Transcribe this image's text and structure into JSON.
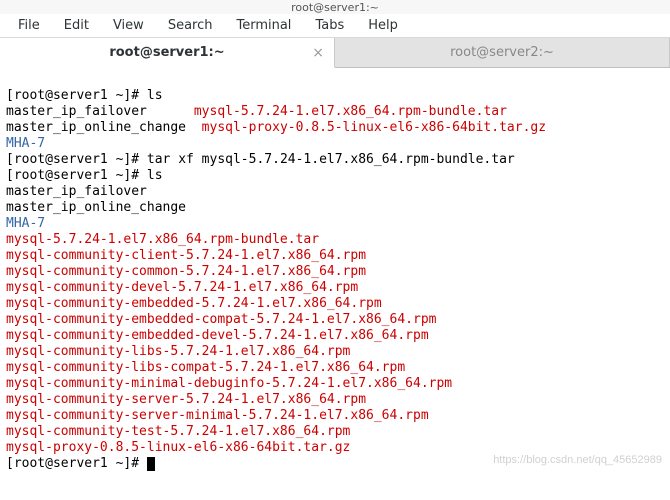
{
  "window": {
    "title": "root@server1:~"
  },
  "menu": {
    "file": "File",
    "edit": "Edit",
    "view": "View",
    "search": "Search",
    "terminal": "Terminal",
    "tabs": "Tabs",
    "help": "Help"
  },
  "tabs": [
    {
      "label": "root@server1:~",
      "active": true
    },
    {
      "label": "root@server2:~",
      "active": false
    }
  ],
  "close_glyph": "×",
  "term": {
    "prompt1": "[root@server1 ~]# ",
    "cmd_ls": "ls",
    "cmd_tar": "tar xf mysql-5.7.24-1.el7.x86_64.rpm-bundle.tar",
    "ls1_left1": "master_ip_failover",
    "ls1_pad1": "      ",
    "ls1_right1": "mysql-5.7.24-1.el7.x86_64.rpm-bundle.tar",
    "ls1_left2": "master_ip_online_change",
    "ls1_pad2": "  ",
    "ls1_right2": "mysql-proxy-0.8.5-linux-el6-x86-64bit.tar.gz",
    "mha": "MHA-7",
    "ls2_l1": "master_ip_failover",
    "ls2_l2": "master_ip_online_change",
    "rpm1": "mysql-5.7.24-1.el7.x86_64.rpm-bundle.tar",
    "rpm2": "mysql-community-client-5.7.24-1.el7.x86_64.rpm",
    "rpm3": "mysql-community-common-5.7.24-1.el7.x86_64.rpm",
    "rpm4": "mysql-community-devel-5.7.24-1.el7.x86_64.rpm",
    "rpm5": "mysql-community-embedded-5.7.24-1.el7.x86_64.rpm",
    "rpm6": "mysql-community-embedded-compat-5.7.24-1.el7.x86_64.rpm",
    "rpm7": "mysql-community-embedded-devel-5.7.24-1.el7.x86_64.rpm",
    "rpm8": "mysql-community-libs-5.7.24-1.el7.x86_64.rpm",
    "rpm9": "mysql-community-libs-compat-5.7.24-1.el7.x86_64.rpm",
    "rpm10": "mysql-community-minimal-debuginfo-5.7.24-1.el7.x86_64.rpm",
    "rpm11": "mysql-community-server-5.7.24-1.el7.x86_64.rpm",
    "rpm12": "mysql-community-server-minimal-5.7.24-1.el7.x86_64.rpm",
    "rpm13": "mysql-community-test-5.7.24-1.el7.x86_64.rpm",
    "proxy": "mysql-proxy-0.8.5-linux-el6-x86-64bit.tar.gz"
  },
  "watermark": "https://blog.csdn.net/qq_45652989"
}
